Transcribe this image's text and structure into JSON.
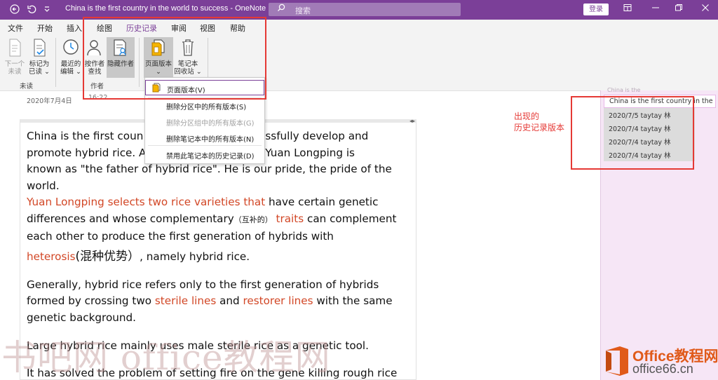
{
  "window": {
    "title": "China is the first country in the world to success  -  OneNote",
    "search_placeholder": "搜索",
    "login_label": "登录"
  },
  "tabs": [
    {
      "label": "文件"
    },
    {
      "label": "开始"
    },
    {
      "label": "插入"
    },
    {
      "label": "绘图"
    },
    {
      "label": "历史记录",
      "active": true
    },
    {
      "label": "审阅"
    },
    {
      "label": "视图"
    },
    {
      "label": "帮助"
    }
  ],
  "ribbon": {
    "unread": {
      "next_unread": [
        "下一个",
        "未读"
      ],
      "mark_read": [
        "标记为",
        "已读 ⌄"
      ],
      "group_label": "未读"
    },
    "author": {
      "recent_edits": [
        "最近的",
        "编辑 ⌄"
      ],
      "find_by_author": [
        "按作者",
        "查找"
      ],
      "hide_authors": [
        "隐藏作者"
      ],
      "group_label": "作者",
      "time": "16:22"
    },
    "history": {
      "page_versions": [
        "页面版本",
        "⌄"
      ],
      "notebook_recycle": [
        "笔记本",
        "回收站 ⌄"
      ]
    }
  },
  "dropdown": {
    "items": [
      {
        "label": "页面版本(V)",
        "disabled": false
      },
      {
        "label": "删除分区中的所有版本(S)",
        "disabled": false
      },
      {
        "label": "删除分区组中的所有版本(G)",
        "disabled": true
      },
      {
        "label": "删除笔记本中的所有版本(N)",
        "disabled": false
      },
      {
        "label": "禁用此笔记本的历史记录(D)",
        "disabled": false
      }
    ]
  },
  "page": {
    "date": "2020年7月4日",
    "p1": {
      "a": "China is the first coun",
      "b": "ccessfully develop and",
      "c": "promote hybrid rice. A",
      "d": "rid rice, Yuan Longping is",
      "e": "known as \"the father of hybrid rice\". He is our pride, the pride of the",
      "f": "world."
    },
    "p2": {
      "red1": "Yuan Longping selects two rice varieties that",
      "t1": " have certain genetic",
      "t2": "differences and whose complementary",
      "small": "（互补的）",
      "red2": "traits",
      "t3": " can complement",
      "t4": "each other to produce the first generation of hybrids with",
      "red3": "heterosis",
      "cn": "(混种优势）",
      "t5": ", namely hybrid rice."
    },
    "p3": {
      "t1": "Generally, hybrid rice refers only to the first generation of hybrids",
      "t2": "formed by crossing two ",
      "red1": "sterile lines",
      "t3": " and ",
      "red2": "restorer lines",
      "t4": " with the same",
      "t5": "genetic background."
    },
    "p4": "Large hybrid rice mainly uses male sterile rice as a genetic tool.",
    "p5": "It has solved the problem of setting fire on the gene killing rough rice"
  },
  "right_pane": {
    "top_fragment": "China is the",
    "current": "China is the first country in the",
    "versions": [
      "2020/7/5 taytay 林",
      "2020/7/4 taytay 林",
      "2020/7/4 taytay 林",
      "2020/7/4 taytay 林"
    ]
  },
  "annotation": {
    "line1": "出现的",
    "line2": "历史记录版本"
  },
  "watermark": {
    "left": "书吧网 office教程网",
    "logo_line1": "Office教程网",
    "logo_line2": "office66.cn"
  },
  "colors": {
    "accent": "#7b3f98",
    "red_text": "#d24726",
    "annotation": "#e53935",
    "pane_bg": "#f6e6f6"
  }
}
